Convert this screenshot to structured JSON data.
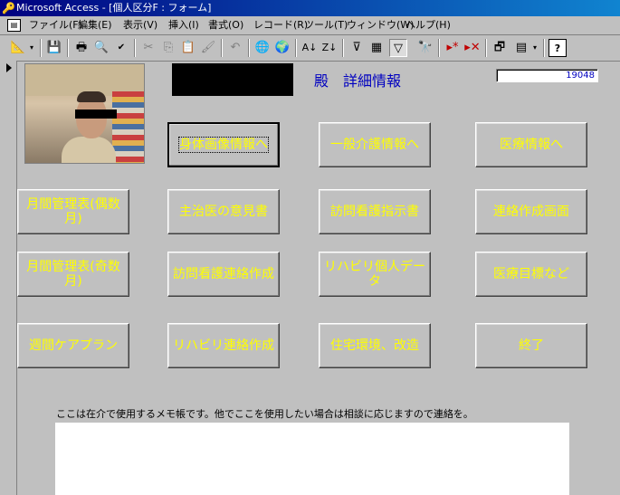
{
  "window": {
    "title": "Microsoft Access - [個人区分F : フォーム]"
  },
  "menu": {
    "items": [
      "ファイル(F)",
      "編集(E)",
      "表示(V)",
      "挿入(I)",
      "書式(O)",
      "レコード(R)",
      "ツール(T)",
      "ウィンドウ(W)",
      "ヘルプ(H)"
    ]
  },
  "toolbar": {
    "icons": [
      "design-view-icon",
      "save-icon",
      "print-icon",
      "print-preview-icon",
      "spelling-icon",
      "cut-icon",
      "copy-icon",
      "paste-icon",
      "format-painter-icon",
      "undo-icon",
      "hyperlink-icon",
      "web-toolbar-icon",
      "sort-ascending-icon",
      "sort-descending-icon",
      "filter-by-selection-icon",
      "filter-by-form-icon",
      "apply-filter-icon",
      "find-icon",
      "new-record-icon",
      "delete-record-icon",
      "database-window-icon",
      "new-object-icon",
      "help-icon"
    ]
  },
  "header": {
    "title": "殿　詳細情報",
    "record_id": "19048"
  },
  "buttons": [
    {
      "label": "身体画像情報へ"
    },
    {
      "label": "一般介護情報へ"
    },
    {
      "label": "医療情報へ"
    },
    {
      "label": "月間管理表(偶数月)"
    },
    {
      "label": "主治医の意見書"
    },
    {
      "label": "訪問看護指示書"
    },
    {
      "label": "連絡作成画面"
    },
    {
      "label": "月間管理表(奇数月)"
    },
    {
      "label": "訪問看護連絡作成"
    },
    {
      "label": "リハビリ個人データ"
    },
    {
      "label": "医療目標など"
    },
    {
      "label": "週間ケアプラン"
    },
    {
      "label": "リハビリ連絡作成"
    },
    {
      "label": "住宅環境、改造"
    },
    {
      "label": "終了"
    }
  ],
  "memo": {
    "label": "ここは在介で使用するメモ帳です。他でここを使用したい場合は相談に応じますので連絡を。",
    "value": ""
  },
  "colors": {
    "button_text": "#ffff00",
    "heading": "#0000c0",
    "background": "#c0c0c0"
  }
}
